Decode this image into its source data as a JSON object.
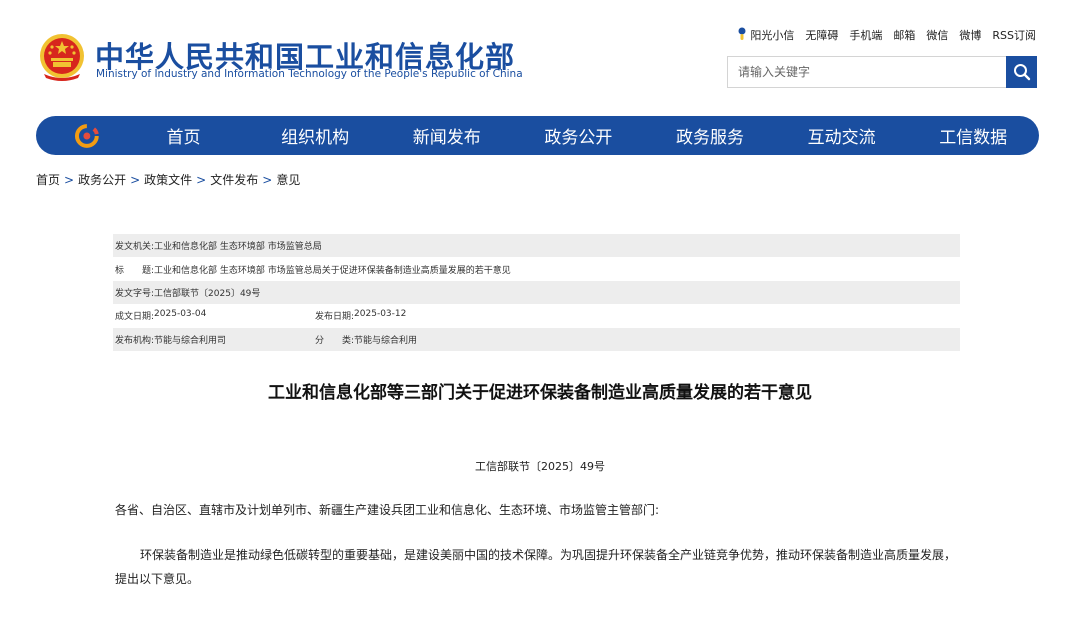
{
  "header": {
    "title": "中华人民共和国工业和信息化部",
    "subtitle": "Ministry of Industry and Information Technology of the People's Republic of China",
    "emblem_icon": "national-emblem-icon",
    "top_links": [
      "阳光小信",
      "无障碍",
      "手机端",
      "邮箱",
      "微信",
      "微博",
      "RSS订阅"
    ],
    "search": {
      "placeholder": "请输入关键字",
      "value": "",
      "button_icon": "search-icon"
    }
  },
  "nav": {
    "logo_icon": "ministry-logo-icon",
    "items": [
      "首页",
      "组织机构",
      "新闻发布",
      "政务公开",
      "政务服务",
      "互动交流",
      "工信数据"
    ]
  },
  "breadcrumb": {
    "items": [
      "首页",
      "政务公开",
      "政策文件",
      "文件发布",
      "意见"
    ],
    "separator": ">"
  },
  "meta": {
    "issuer_label": "发文机关:",
    "issuer_value": "工业和信息化部 生态环境部 市场监管总局",
    "title_label": "标　　题:",
    "title_value": "工业和信息化部 生态环境部 市场监管总局关于促进环保装备制造业高质量发展的若干意见",
    "docno_label": "发文字号:",
    "docno_value": "工信部联节〔2025〕49号",
    "created_label": "成文日期:",
    "created_value": "2025-03-04",
    "published_label": "发布日期:",
    "published_value": "2025-03-12",
    "agency_label": "发布机构:",
    "agency_value": "节能与综合利用司",
    "category_label": "分　　类:",
    "category_value": "节能与综合利用"
  },
  "article": {
    "title": "工业和信息化部等三部门关于促进环保装备制造业高质量发展的若干意见",
    "doc_number": "工信部联节〔2025〕49号",
    "addressee": "各省、自治区、直辖市及计划单列市、新疆生产建设兵团工业和信息化、生态环境、市场监管主管部门:",
    "paragraph1": "环保装备制造业是推动绿色低碳转型的重要基础，是建设美丽中国的技术保障。为巩固提升环保装备全产业链竞争优势，推动环保装备制造业高质量发展，提出以下意见。"
  },
  "colors": {
    "brand": "#1a4ea0",
    "meta_row_shade": "#ededed",
    "emblem_red": "#d7261d",
    "emblem_gold": "#f1c232"
  }
}
